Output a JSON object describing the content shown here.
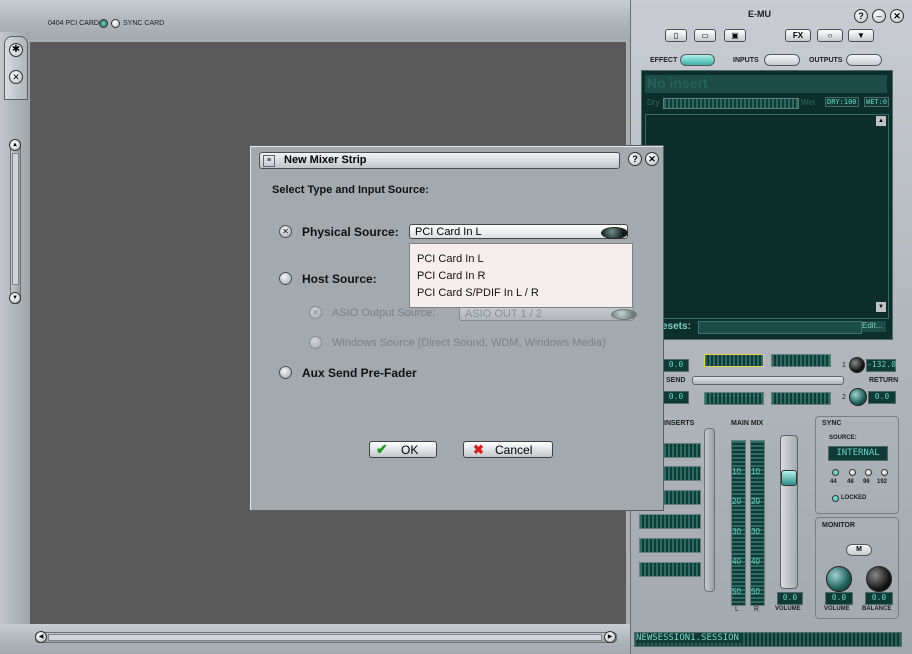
{
  "topbar": {
    "card_label": "0404 PCI CARD",
    "sync_label": "SYNC CARD",
    "brand": "E-MU"
  },
  "right_panel": {
    "tabs": {
      "effect": "EFFECT",
      "inputs": "INPUTS",
      "outputs": "OUTPUTS"
    },
    "insert_name": "No insert",
    "dry_label": "Dry",
    "wet_label": "Wet",
    "dry_value": "DRY:100",
    "wet_value": "WET:0",
    "presets_label": "esets:",
    "edit_label": "Edit...",
    "send_label": "SEND",
    "return_label": "RETURN",
    "return_value": "-132.0",
    "send_top_value": "0.0",
    "send_bottom_value": "0.0",
    "return_bottom_value": "0.0",
    "return_top_num": "1",
    "return_bottom_num": "2",
    "inserts_label": "INSERTS",
    "main_mix_label": "MAIN MIX",
    "meter_scale": [
      "10",
      "20",
      "30",
      "40",
      "50"
    ],
    "meter_lr": [
      "L",
      "R"
    ],
    "main_volume_value": "0.0",
    "volume_label": "VOLUME",
    "sync": {
      "title": "SYNC",
      "source_label": "SOURCE:",
      "source_value": "INTERNAL",
      "rates": [
        "44",
        "48",
        "96",
        "192"
      ],
      "locked_label": "LOCKED"
    },
    "monitor": {
      "title": "MONITOR",
      "m_label": "M",
      "volume_value": "0.0",
      "balance_value": "0.0",
      "volume_label": "VOLUME",
      "balance_label": "BALANCE"
    },
    "session_name": "NEWSESSION1.SESSION"
  },
  "dialog": {
    "title": "New Mixer Strip",
    "heading": "Select Type and Input Source:",
    "physical_label": "Physical Source:",
    "physical_value": "PCI Card In L",
    "dropdown_options": [
      "PCI Card In L",
      "PCI Card In R",
      "PCI Card S/PDIF In L / R"
    ],
    "host_label": "Host Source:",
    "asio_label": "ASIO Output Source:",
    "asio_value": "ASIO OUT 1 / 2",
    "windows_label": "Windows Source (Direct Sound, WDM, Windows Media)",
    "aux_label": "Aux Send Pre-Fader",
    "ok_label": "OK",
    "cancel_label": "Cancel"
  }
}
